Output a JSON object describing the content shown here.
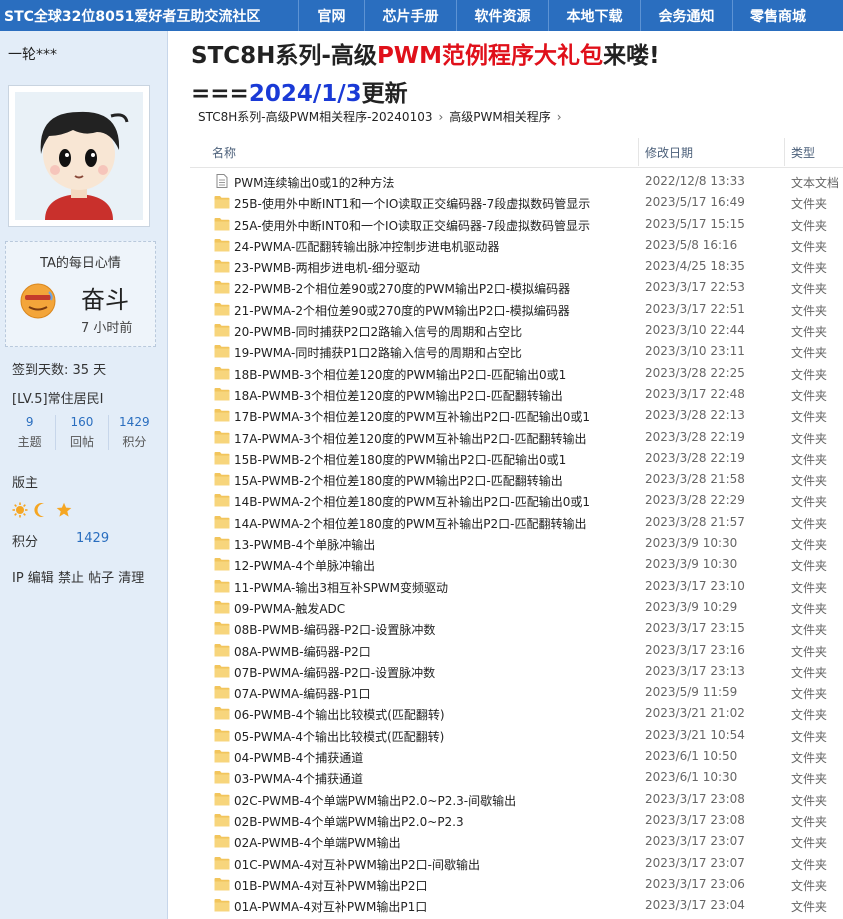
{
  "site": {
    "title": "STC全球32位8051爱好者互助交流社区",
    "nav": [
      "官网",
      "芯片手册",
      "软件资源",
      "本地下载",
      "会务通知",
      "零售商城"
    ]
  },
  "sidebar": {
    "username": "一轮***",
    "mood": {
      "title": "TA的每日心情",
      "text": "奋斗",
      "time": "7 小时前"
    },
    "signin": "签到天数: 35 天",
    "level": "[LV.5]常住居民I",
    "stats": [
      {
        "value": "9",
        "label": "主题"
      },
      {
        "value": "160",
        "label": "回帖"
      },
      {
        "value": "1429",
        "label": "积分"
      }
    ],
    "role": "版主",
    "badges": [
      "sun-icon",
      "moon-icon",
      "star-icon"
    ],
    "points_label": "积分",
    "points_value": "1429",
    "admin_links": "IP 编辑 禁止 帖子 清理"
  },
  "post": {
    "title_prefix": "STC8H系列-高级",
    "title_highlight": "PWM范例程序大礼包",
    "title_suffix": "来喽!",
    "subtitle_prefix": "===",
    "subtitle_date": "2024/1/3",
    "subtitle_suffix": "更新"
  },
  "explorer": {
    "breadcrumb": [
      "STC8H系列-高级PWM相关程序-20240103",
      "高级PWM相关程序"
    ],
    "columns": {
      "name": "名称",
      "date": "修改日期",
      "type": "类型"
    },
    "rows": [
      {
        "name": "PWM连续输出0或1的2种方法",
        "date": "2022/12/8 13:33",
        "type": "文本文档",
        "icon": "text-file-icon"
      },
      {
        "name": "25B-使用外中断INT1和一个IO读取正交编码器-7段虚拟数码管显示",
        "date": "2023/5/17 16:49",
        "type": "文件夹",
        "icon": "folder-icon"
      },
      {
        "name": "25A-使用外中断INT0和一个IO读取正交编码器-7段虚拟数码管显示",
        "date": "2023/5/17 15:15",
        "type": "文件夹",
        "icon": "folder-icon"
      },
      {
        "name": "24-PWMA-匹配翻转输出脉冲控制步进电机驱动器",
        "date": "2023/5/8 16:16",
        "type": "文件夹",
        "icon": "folder-icon"
      },
      {
        "name": "23-PWMB-两相步进电机-细分驱动",
        "date": "2023/4/25 18:35",
        "type": "文件夹",
        "icon": "folder-icon"
      },
      {
        "name": "22-PWMB-2个相位差90或270度的PWM输出P2口-模拟编码器",
        "date": "2023/3/17 22:53",
        "type": "文件夹",
        "icon": "folder-icon"
      },
      {
        "name": "21-PWMA-2个相位差90或270度的PWM输出P2口-模拟编码器",
        "date": "2023/3/17 22:51",
        "type": "文件夹",
        "icon": "folder-icon"
      },
      {
        "name": "20-PWMB-同时捕获P2口2路输入信号的周期和占空比",
        "date": "2023/3/10 22:44",
        "type": "文件夹",
        "icon": "folder-icon"
      },
      {
        "name": "19-PWMA-同时捕获P1口2路输入信号的周期和占空比",
        "date": "2023/3/10 23:11",
        "type": "文件夹",
        "icon": "folder-icon"
      },
      {
        "name": "18B-PWMB-3个相位差120度的PWM输出P2口-匹配输出0或1",
        "date": "2023/3/28 22:25",
        "type": "文件夹",
        "icon": "folder-icon"
      },
      {
        "name": "18A-PWMB-3个相位差120度的PWM输出P2口-匹配翻转输出",
        "date": "2023/3/17 22:48",
        "type": "文件夹",
        "icon": "folder-icon"
      },
      {
        "name": "17B-PWMA-3个相位差120度的PWM互补输出P2口-匹配输出0或1",
        "date": "2023/3/28 22:13",
        "type": "文件夹",
        "icon": "folder-icon"
      },
      {
        "name": "17A-PWMA-3个相位差120度的PWM互补输出P2口-匹配翻转输出",
        "date": "2023/3/28 22:19",
        "type": "文件夹",
        "icon": "folder-icon"
      },
      {
        "name": "15B-PWMB-2个相位差180度的PWM输出P2口-匹配输出0或1",
        "date": "2023/3/28 22:19",
        "type": "文件夹",
        "icon": "folder-icon"
      },
      {
        "name": "15A-PWMB-2个相位差180度的PWM输出P2口-匹配翻转输出",
        "date": "2023/3/28 21:58",
        "type": "文件夹",
        "icon": "folder-icon"
      },
      {
        "name": "14B-PWMA-2个相位差180度的PWM互补输出P2口-匹配输出0或1",
        "date": "2023/3/28 22:29",
        "type": "文件夹",
        "icon": "folder-icon"
      },
      {
        "name": "14A-PWMA-2个相位差180度的PWM互补输出P2口-匹配翻转输出",
        "date": "2023/3/28 21:57",
        "type": "文件夹",
        "icon": "folder-icon"
      },
      {
        "name": "13-PWMB-4个单脉冲输出",
        "date": "2023/3/9 10:30",
        "type": "文件夹",
        "icon": "folder-icon"
      },
      {
        "name": "12-PWMA-4个单脉冲输出",
        "date": "2023/3/9 10:30",
        "type": "文件夹",
        "icon": "folder-icon"
      },
      {
        "name": "11-PWMA-输出3相互补SPWM变频驱动",
        "date": "2023/3/17 23:10",
        "type": "文件夹",
        "icon": "folder-icon"
      },
      {
        "name": "09-PWMA-触发ADC",
        "date": "2023/3/9 10:29",
        "type": "文件夹",
        "icon": "folder-icon"
      },
      {
        "name": "08B-PWMB-编码器-P2口-设置脉冲数",
        "date": "2023/3/17 23:15",
        "type": "文件夹",
        "icon": "folder-icon"
      },
      {
        "name": "08A-PWMB-编码器-P2口",
        "date": "2023/3/17 23:16",
        "type": "文件夹",
        "icon": "folder-icon"
      },
      {
        "name": "07B-PWMA-编码器-P2口-设置脉冲数",
        "date": "2023/3/17 23:13",
        "type": "文件夹",
        "icon": "folder-icon"
      },
      {
        "name": "07A-PWMA-编码器-P1口",
        "date": "2023/5/9 11:59",
        "type": "文件夹",
        "icon": "folder-icon"
      },
      {
        "name": "06-PWMB-4个输出比较模式(匹配翻转)",
        "date": "2023/3/21 21:02",
        "type": "文件夹",
        "icon": "folder-icon"
      },
      {
        "name": "05-PWMA-4个输出比较模式(匹配翻转)",
        "date": "2023/3/21 10:54",
        "type": "文件夹",
        "icon": "folder-icon"
      },
      {
        "name": "04-PWMB-4个捕获通道",
        "date": "2023/6/1 10:50",
        "type": "文件夹",
        "icon": "folder-icon"
      },
      {
        "name": "03-PWMA-4个捕获通道",
        "date": "2023/6/1 10:30",
        "type": "文件夹",
        "icon": "folder-icon"
      },
      {
        "name": "02C-PWMB-4个单端PWM输出P2.0~P2.3-间歇输出",
        "date": "2023/3/17 23:08",
        "type": "文件夹",
        "icon": "folder-icon"
      },
      {
        "name": "02B-PWMB-4个单端PWM输出P2.0~P2.3",
        "date": "2023/3/17 23:08",
        "type": "文件夹",
        "icon": "folder-icon"
      },
      {
        "name": "02A-PWMB-4个单端PWM输出",
        "date": "2023/3/17 23:07",
        "type": "文件夹",
        "icon": "folder-icon"
      },
      {
        "name": "01C-PWMA-4对互补PWM输出P2口-间歇输出",
        "date": "2023/3/17 23:07",
        "type": "文件夹",
        "icon": "folder-icon"
      },
      {
        "name": "01B-PWMA-4对互补PWM输出P2口",
        "date": "2023/3/17 23:06",
        "type": "文件夹",
        "icon": "folder-icon"
      },
      {
        "name": "01A-PWMA-4对互补PWM输出P1口",
        "date": "2023/3/17 23:04",
        "type": "文件夹",
        "icon": "folder-icon"
      }
    ]
  },
  "colors": {
    "nav_bg": "#2a6ebf",
    "sidebar_bg": "#e3edf8",
    "title_red": "#e0101a",
    "title_blue": "#1a3ad6",
    "folder": "#f2c55c",
    "link": "#2a6ebf"
  }
}
